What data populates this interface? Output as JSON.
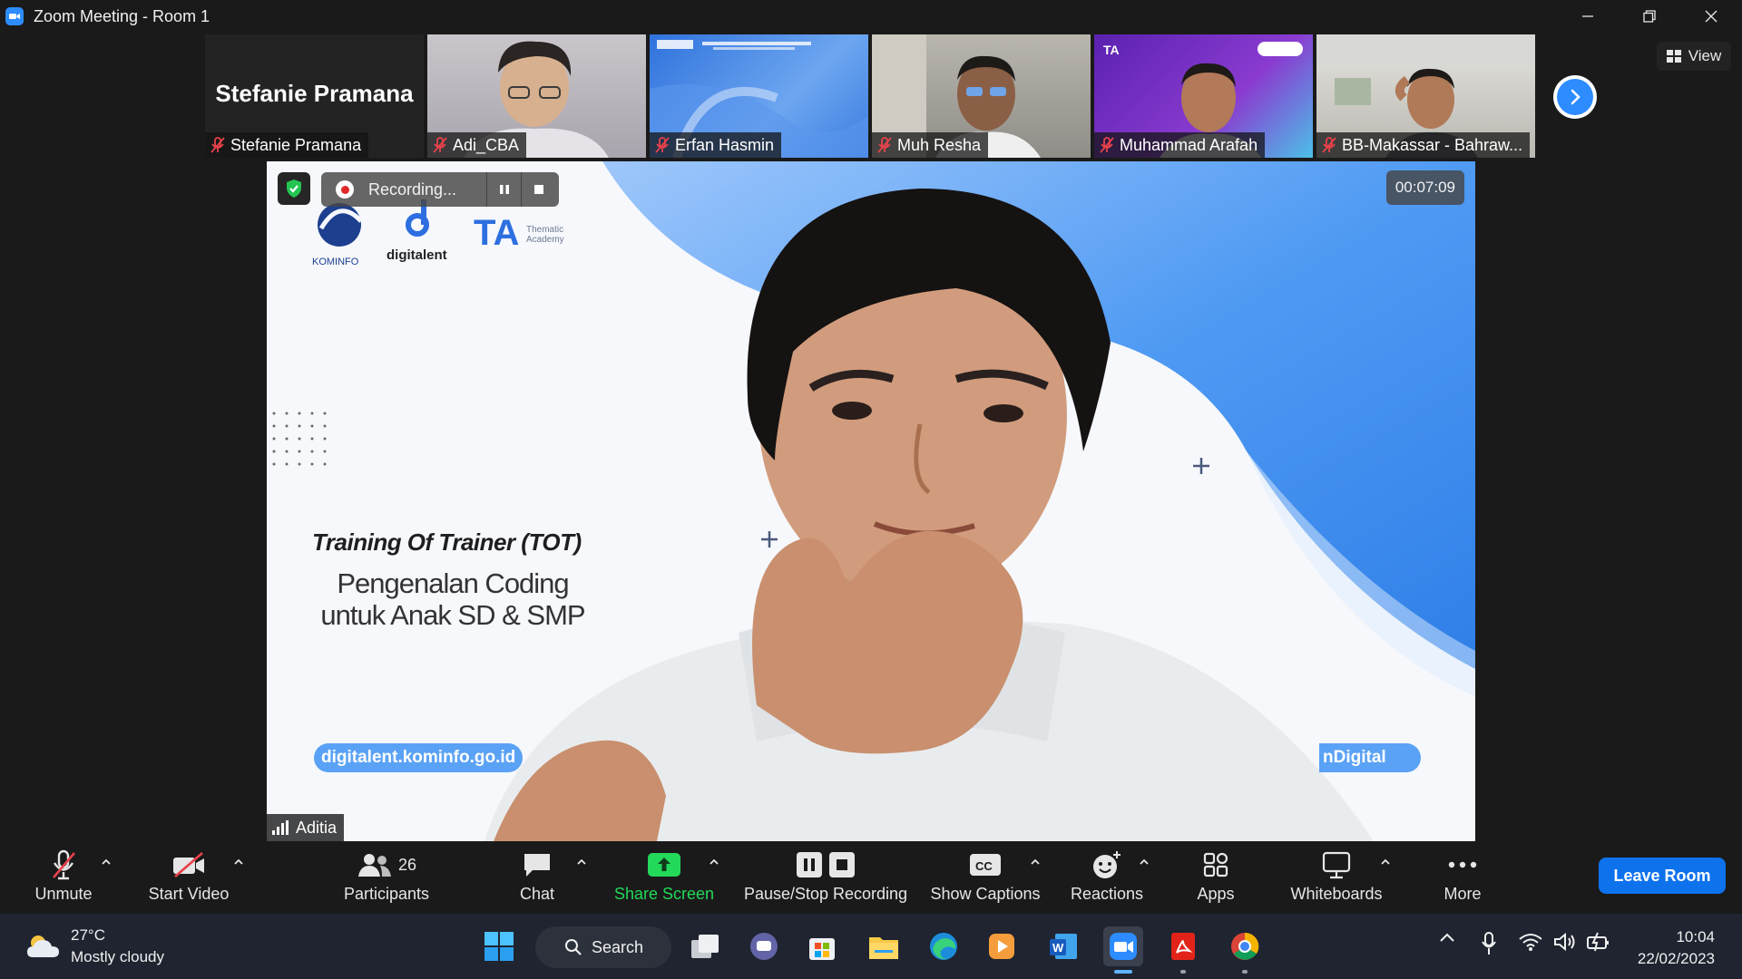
{
  "window": {
    "title": "Zoom Meeting - Room 1",
    "minimize": "—",
    "restore": "❐",
    "close": "✕"
  },
  "participants_strip": [
    {
      "name": "Stefanie Pramana",
      "display_big_name": "Stefanie Pramana",
      "muted": true,
      "bg": "#232323"
    },
    {
      "name": "Adi_CBA",
      "muted": true,
      "bg": "#b8b4b8"
    },
    {
      "name": "Erfan Hasmin",
      "muted": true,
      "bg": "#2e6ed8"
    },
    {
      "name": "Muh Resha",
      "muted": true,
      "bg": "#a7a79e"
    },
    {
      "name": "Muhammad Arafah",
      "muted": true,
      "bg": "#6b2ab8"
    },
    {
      "name": "BB-Makassar - Bahraw...",
      "muted": true,
      "bg": "#c8c6c2"
    }
  ],
  "view_button": "View",
  "main_video": {
    "speaker_name": "Aditia",
    "recording_label": "Recording...",
    "elapsed_time": "00:07:09",
    "slide": {
      "logos": [
        "KOMINFO",
        "digitalent",
        "TA",
        "Thematic Academy"
      ],
      "heading": "Training Of Trainer (TOT)",
      "subtitle_line1": "Pengenalan Coding",
      "subtitle_line2": "untuk Anak SD & SMP",
      "url": "digitalent.kominfo.go.id",
      "tag": "nDigital"
    }
  },
  "toolbar": {
    "unmute": "Unmute",
    "start_video": "Start Video",
    "participants": "Participants",
    "participants_count": "26",
    "chat": "Chat",
    "share_screen": "Share Screen",
    "pause_stop_recording": "Pause/Stop Recording",
    "show_captions": "Show Captions",
    "reactions": "Reactions",
    "apps": "Apps",
    "whiteboards": "Whiteboards",
    "more": "More",
    "leave_room": "Leave Room",
    "share_color": "#23d959",
    "leave_color": "#0e72ed"
  },
  "taskbar": {
    "weather_temp": "27°C",
    "weather_desc": "Mostly cloudy",
    "search_label": "Search",
    "time": "10:04",
    "date": "22/02/2023"
  }
}
